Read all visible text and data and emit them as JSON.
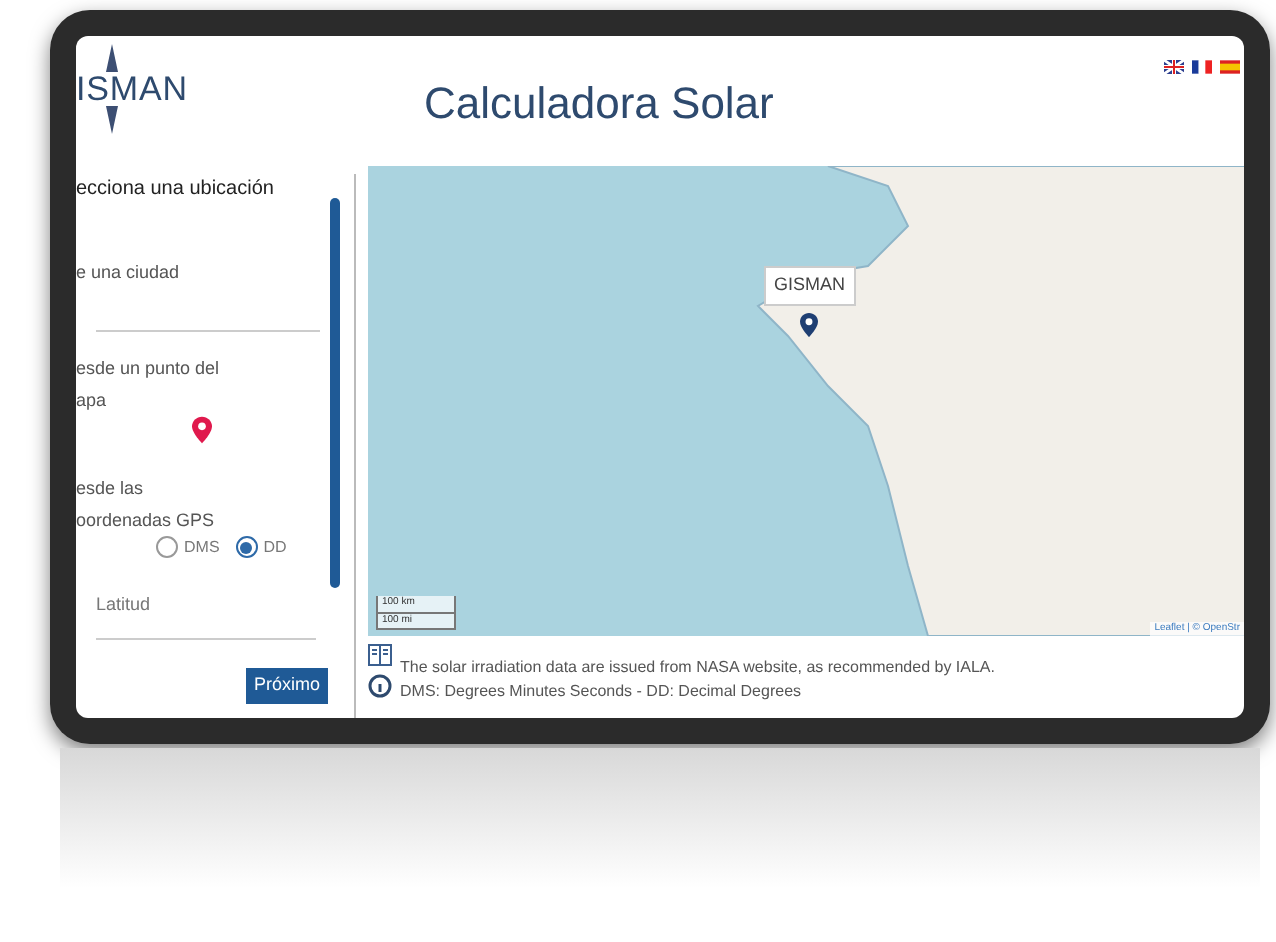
{
  "logo": {
    "text": "ISMAN"
  },
  "header": {
    "title": "Calculadora Solar"
  },
  "sidebar": {
    "heading": "ecciona una ubicación",
    "city": {
      "label": "e una ciudad"
    },
    "map_point": {
      "lines": [
        "esde un punto del",
        "apa"
      ]
    },
    "gps": {
      "lines": [
        "esde las",
        "oordenadas GPS"
      ],
      "formats": [
        {
          "label": "DMS",
          "selected": false
        },
        {
          "label": "DD",
          "selected": true
        }
      ],
      "latitude": {
        "placeholder": "Latitud"
      }
    },
    "next_button": "Próximo"
  },
  "map": {
    "popup": "GISMAN",
    "scale": [
      "100 km",
      "100 mi"
    ],
    "attribution": "Leaflet | © OpenStr"
  },
  "notes": [
    "The solar irradiation data are issued from NASA website, as recommended by IALA.",
    "DMS: Degrees Minutes Seconds - DD: Decimal Degrees"
  ]
}
